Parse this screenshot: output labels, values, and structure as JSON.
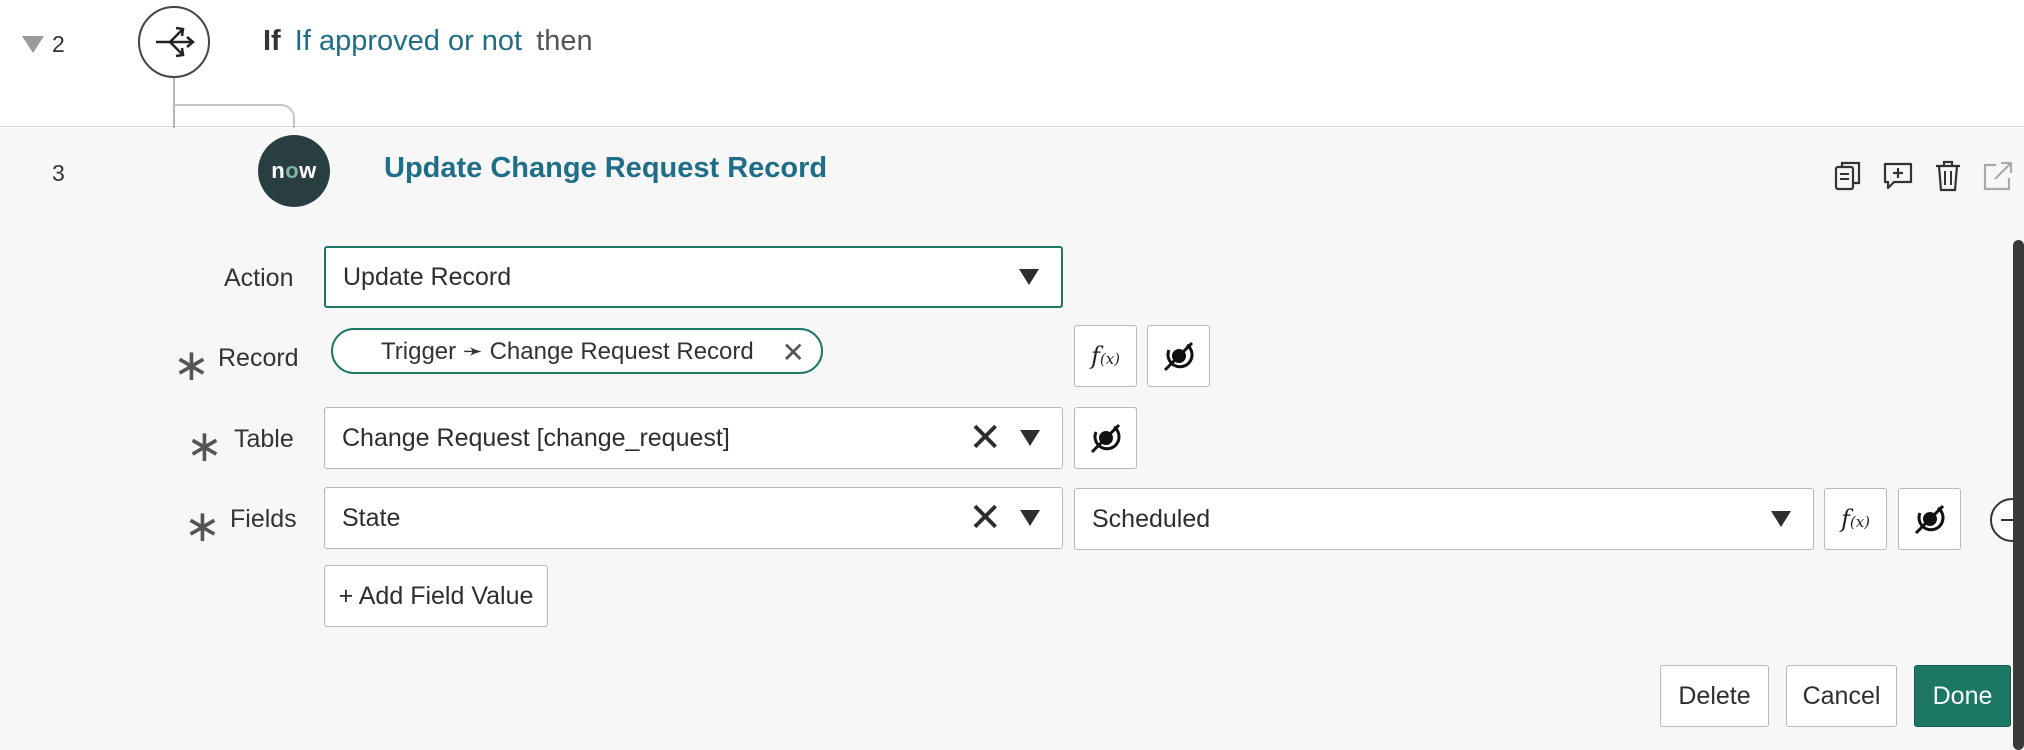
{
  "step2": {
    "number": "2",
    "if_keyword": "If",
    "condition": "If approved or not",
    "then_keyword": "then"
  },
  "step3": {
    "number": "3",
    "logo_text_n": "n",
    "logo_text_o": "o",
    "logo_text_w": "w",
    "title": "Update Change Request Record"
  },
  "form": {
    "action": {
      "label": "Action",
      "value": "Update Record"
    },
    "record": {
      "label": "Record",
      "pill_text": "Trigger ➛ Change Request Record"
    },
    "table": {
      "label": "Table",
      "value": "Change Request [change_request]"
    },
    "fields": {
      "label": "Fields",
      "field_name": "State",
      "field_value": "Scheduled"
    },
    "add_field_label": "+ Add Field Value",
    "fx_label": "f",
    "fx_sub": "(x)"
  },
  "buttons": {
    "delete": "Delete",
    "cancel": "Cancel",
    "done": "Done"
  },
  "colors": {
    "accent": "#1c7765",
    "link": "#1f6e87",
    "logo_bg": "#293e40"
  },
  "icons": [
    "copy-icon",
    "comment-add-icon",
    "trash-icon",
    "open-external-icon",
    "data-pill-picker-icon",
    "flow-branch-icon"
  ]
}
